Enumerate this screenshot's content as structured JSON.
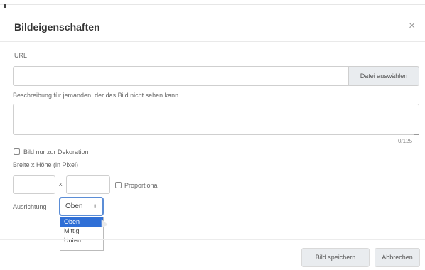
{
  "dialog": {
    "title": "Bildeigenschaften",
    "close_glyph": "×"
  },
  "url": {
    "label": "URL",
    "value": "",
    "file_button": "Datei auswählen"
  },
  "description": {
    "label": "Beschreibung für jemanden, der das Bild nicht sehen kann",
    "value": "",
    "counter": "0/125"
  },
  "decorative": {
    "label": "Bild nur zur Dekoration",
    "checked": false
  },
  "size": {
    "label": "Breite x Höhe (in Pixel)",
    "width": "",
    "height": "",
    "separator": "x",
    "proportional_label": "Proportional",
    "proportional_checked": false
  },
  "alignment": {
    "label": "Ausrichtung",
    "selected": "Oben",
    "arrow_glyph": "⇕",
    "options": [
      "Oben",
      "Mittig",
      "Unten"
    ]
  },
  "footer": {
    "save_label": "Bild speichern",
    "cancel_label": "Abbrechen"
  },
  "colors": {
    "accent": "#2f6fd6",
    "focus_border": "#5b8dd6",
    "button_bg": "#e9ecef"
  }
}
